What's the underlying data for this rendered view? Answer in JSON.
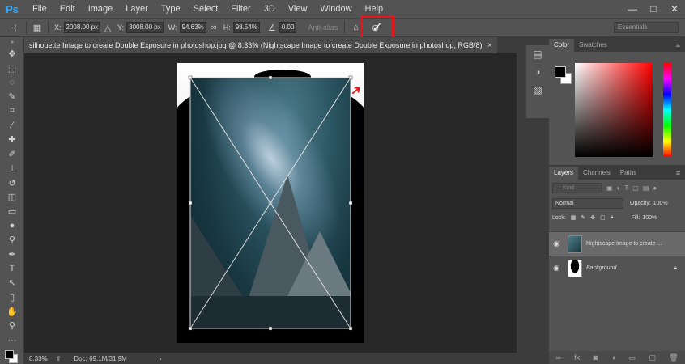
{
  "app": {
    "logo": "Ps"
  },
  "menu": [
    "File",
    "Edit",
    "Image",
    "Layer",
    "Type",
    "Select",
    "Filter",
    "3D",
    "View",
    "Window",
    "Help"
  ],
  "window_controls": [
    "—",
    "□",
    "✕"
  ],
  "options": {
    "x_label": "X:",
    "x_value": "2008.00 px",
    "y_label": "Y:",
    "y_value": "3008.00 px",
    "w_label": "W:",
    "w_value": "94.63%",
    "h_label": "H:",
    "h_value": "98.54%",
    "angle_value": "0.00",
    "anti_alias_label": "Anti-alias",
    "cancel_glyph": "⊘",
    "commit_glyph": "✓",
    "workspace": "Essentials",
    "highlight_color": "#e8141b"
  },
  "document": {
    "tab_title": "silhouette Image to create Double Exposure in photoshop.jpg @ 8.33% (Nightscape Image to create Double Exposure in photoshop, RGB/8)",
    "close": "×"
  },
  "status": {
    "zoom": "8.33%",
    "doc_size": "Doc: 69.1M/31.9M",
    "arrow": "›"
  },
  "color_panel": {
    "tabs": [
      "Color",
      "Swatches"
    ]
  },
  "layers_panel": {
    "tabs": [
      "Layers",
      "Channels",
      "Paths"
    ],
    "kind_placeholder": "Kind",
    "blend_mode": "Normal",
    "opacity_label": "Opacity:",
    "opacity_value": "100%",
    "lock_label": "Lock:",
    "fill_label": "Fill:",
    "fill_value": "100%",
    "layers": [
      {
        "name": "Nightscape Image to create ...",
        "selected": true
      },
      {
        "name": "Background",
        "selected": false,
        "locked": true
      }
    ]
  }
}
